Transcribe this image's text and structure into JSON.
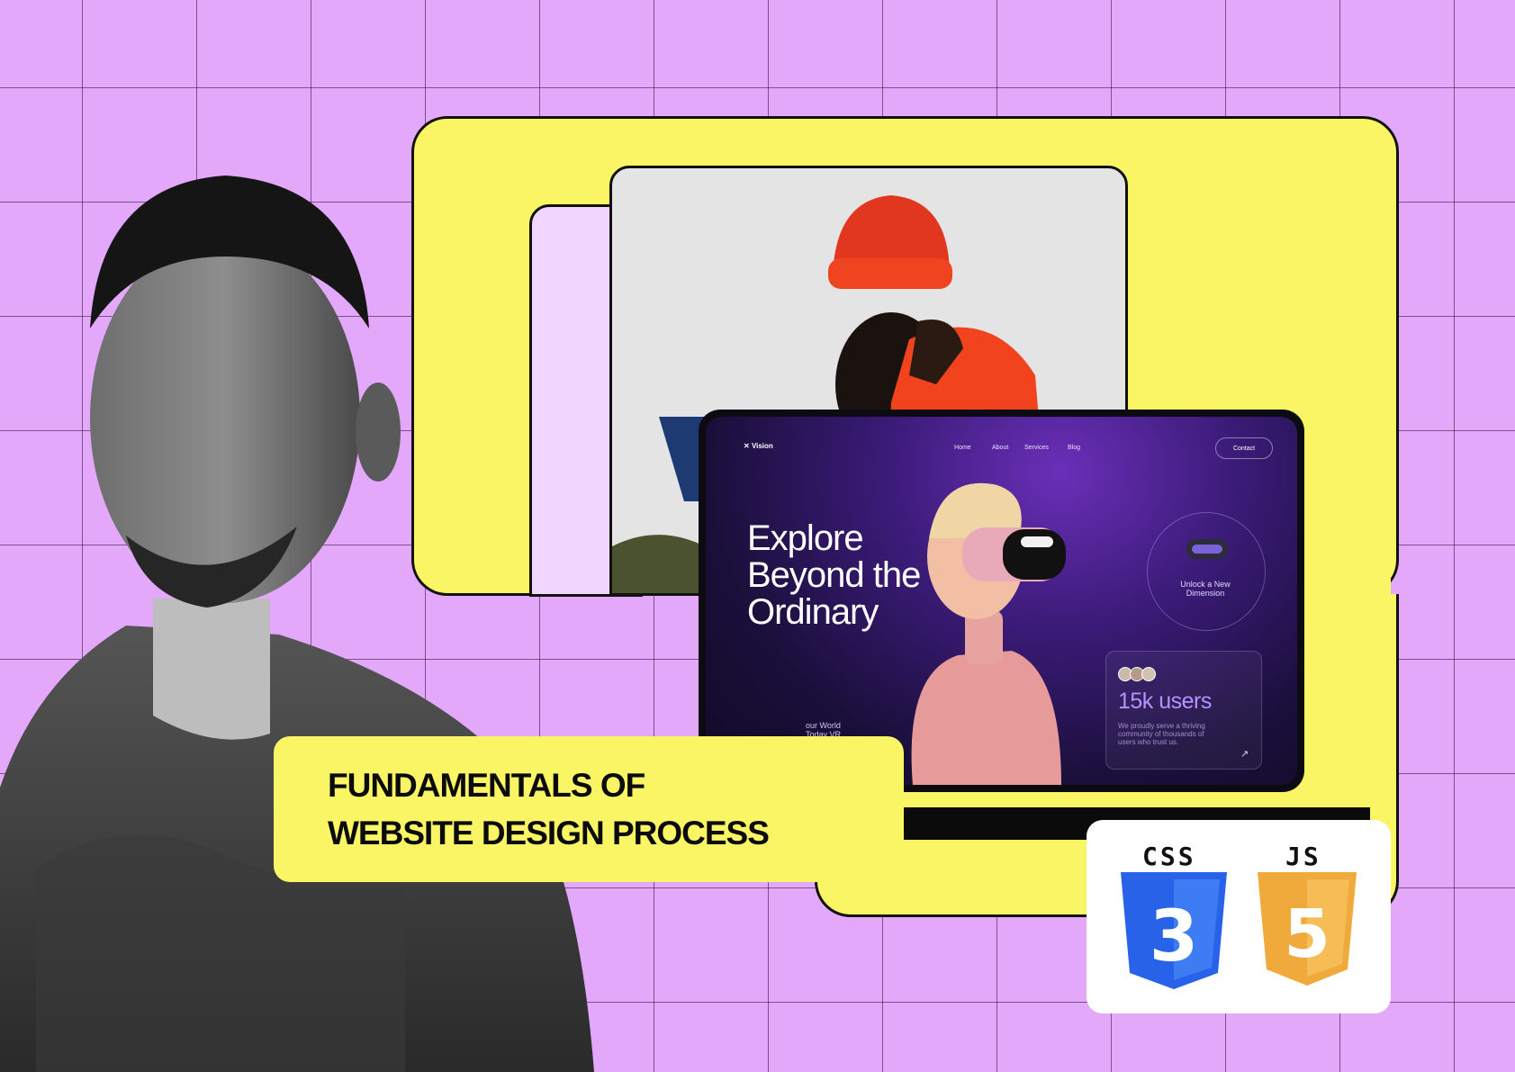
{
  "title": {
    "line1": "FUNDAMENTALS OF",
    "line2": "WEBSITE DESIGN PROCESS"
  },
  "website_mockup": {
    "brand": "Vision",
    "nav": [
      "Home",
      "About",
      "Services",
      "Blog"
    ],
    "contact": "Contact",
    "hero_line1": "Explore",
    "hero_line2": "Beyond the",
    "hero_line3": "Ordinary",
    "hero_sub_line1": "our World",
    "hero_sub_line2": "Today VR",
    "vr_label_line1": "Unlock a New",
    "vr_label_line2": "Dimension",
    "users_count": "15k users",
    "users_text": "We proudly serve a thriving community of thousands of users who trust us."
  },
  "logos": {
    "css_label": "CSS",
    "css_digit": "3",
    "js_label": "JS",
    "js_digit": "5",
    "css_color": "#2862e9",
    "js_color": "#f0a93b"
  },
  "colors": {
    "background": "#e4a8fb",
    "accent_yellow": "#faf564",
    "mockup_purple": "#3b1b78"
  }
}
